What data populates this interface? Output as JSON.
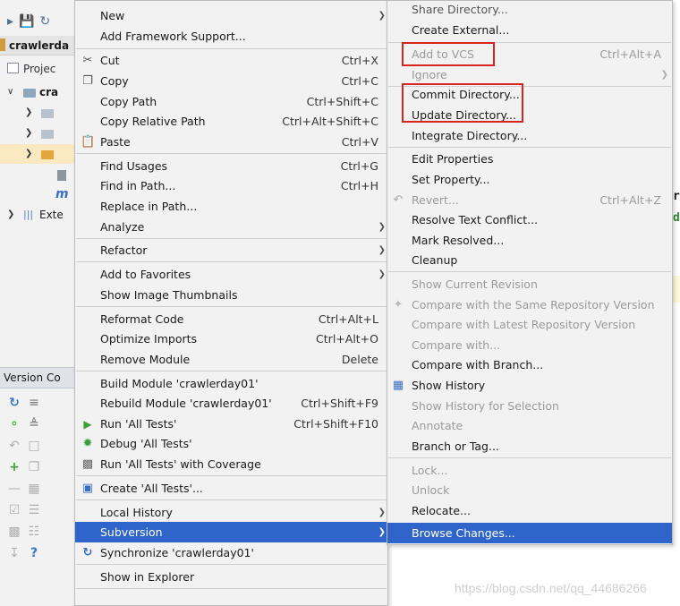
{
  "ide": {
    "project_name": "crawlerda",
    "project_tab": "Projec",
    "tree_root": "cra",
    "external_libs": "Exte",
    "version_control_tab": "Version Co"
  },
  "editor": {
    "char_r": "r",
    "char_d": "d"
  },
  "main_menu": {
    "items": [
      {
        "label": "New",
        "submenu": true
      },
      {
        "label": "Add Framework Support..."
      },
      {
        "label": "Cut",
        "shortcut": "Ctrl+X",
        "icon": "scissors-icon"
      },
      {
        "label": "Copy",
        "shortcut": "Ctrl+C",
        "icon": "copy-icon"
      },
      {
        "label": "Copy Path",
        "shortcut": "Ctrl+Shift+C"
      },
      {
        "label": "Copy Relative Path",
        "shortcut": "Ctrl+Alt+Shift+C"
      },
      {
        "label": "Paste",
        "shortcut": "Ctrl+V",
        "icon": "paste-icon"
      },
      {
        "label": "Find Usages",
        "shortcut": "Ctrl+G"
      },
      {
        "label": "Find in Path...",
        "shortcut": "Ctrl+H"
      },
      {
        "label": "Replace in Path..."
      },
      {
        "label": "Analyze",
        "submenu": true
      },
      {
        "label": "Refactor",
        "submenu": true
      },
      {
        "label": "Add to Favorites",
        "submenu": true
      },
      {
        "label": "Show Image Thumbnails"
      },
      {
        "label": "Reformat Code",
        "shortcut": "Ctrl+Alt+L"
      },
      {
        "label": "Optimize Imports",
        "shortcut": "Ctrl+Alt+O"
      },
      {
        "label": "Remove Module",
        "shortcut": "Delete"
      },
      {
        "label": "Build Module 'crawlerday01'"
      },
      {
        "label": "Rebuild Module 'crawlerday01'",
        "shortcut": "Ctrl+Shift+F9"
      },
      {
        "label": "Run 'All Tests'",
        "shortcut": "Ctrl+Shift+F10",
        "icon": "run-icon"
      },
      {
        "label": "Debug 'All Tests'",
        "icon": "debug-icon"
      },
      {
        "label": "Run 'All Tests' with Coverage",
        "icon": "coverage-icon"
      },
      {
        "label": "Create 'All Tests'...",
        "icon": "create-test-icon"
      },
      {
        "label": "Local History",
        "submenu": true
      },
      {
        "label": "Subversion",
        "submenu": true,
        "active": true
      },
      {
        "label": "Synchronize 'crawlerday01'",
        "icon": "sync-icon"
      },
      {
        "label": "Show in Explorer"
      }
    ]
  },
  "subversion_menu": {
    "items": [
      {
        "label": "Share Directory..."
      },
      {
        "label": "Create External..."
      },
      {
        "label": "Add to VCS",
        "shortcut": "Ctrl+Alt+A",
        "disabled": true
      },
      {
        "label": "Ignore",
        "submenu": true,
        "disabled": true
      },
      {
        "label": "Commit Directory..."
      },
      {
        "label": "Update Directory..."
      },
      {
        "label": "Integrate Directory..."
      },
      {
        "label": "Edit Properties"
      },
      {
        "label": "Set Property..."
      },
      {
        "label": "Revert...",
        "shortcut": "Ctrl+Alt+Z",
        "disabled": true,
        "icon": "revert-icon"
      },
      {
        "label": "Resolve Text Conflict..."
      },
      {
        "label": "Mark Resolved..."
      },
      {
        "label": "Cleanup"
      },
      {
        "label": "Show Current Revision",
        "disabled": true
      },
      {
        "label": "Compare with the Same Repository Version",
        "disabled": true,
        "icon": "compare-icon"
      },
      {
        "label": "Compare with Latest Repository Version",
        "disabled": true
      },
      {
        "label": "Compare with...",
        "disabled": true
      },
      {
        "label": "Compare with Branch..."
      },
      {
        "label": "Show History",
        "icon": "history-icon"
      },
      {
        "label": "Show History for Selection",
        "disabled": true
      },
      {
        "label": "Annotate",
        "disabled": true
      },
      {
        "label": "Branch or Tag..."
      },
      {
        "label": "Lock...",
        "disabled": true
      },
      {
        "label": "Unlock",
        "disabled": true
      },
      {
        "label": "Relocate..."
      },
      {
        "label": "Browse Changes...",
        "active": true
      }
    ]
  },
  "watermark": "https://blog.csdn.net/qq_44686266",
  "colors": {
    "highlight": "#2f65ca",
    "annotation_red": "#d6261f",
    "menu_bg": "#f2f2f2"
  }
}
